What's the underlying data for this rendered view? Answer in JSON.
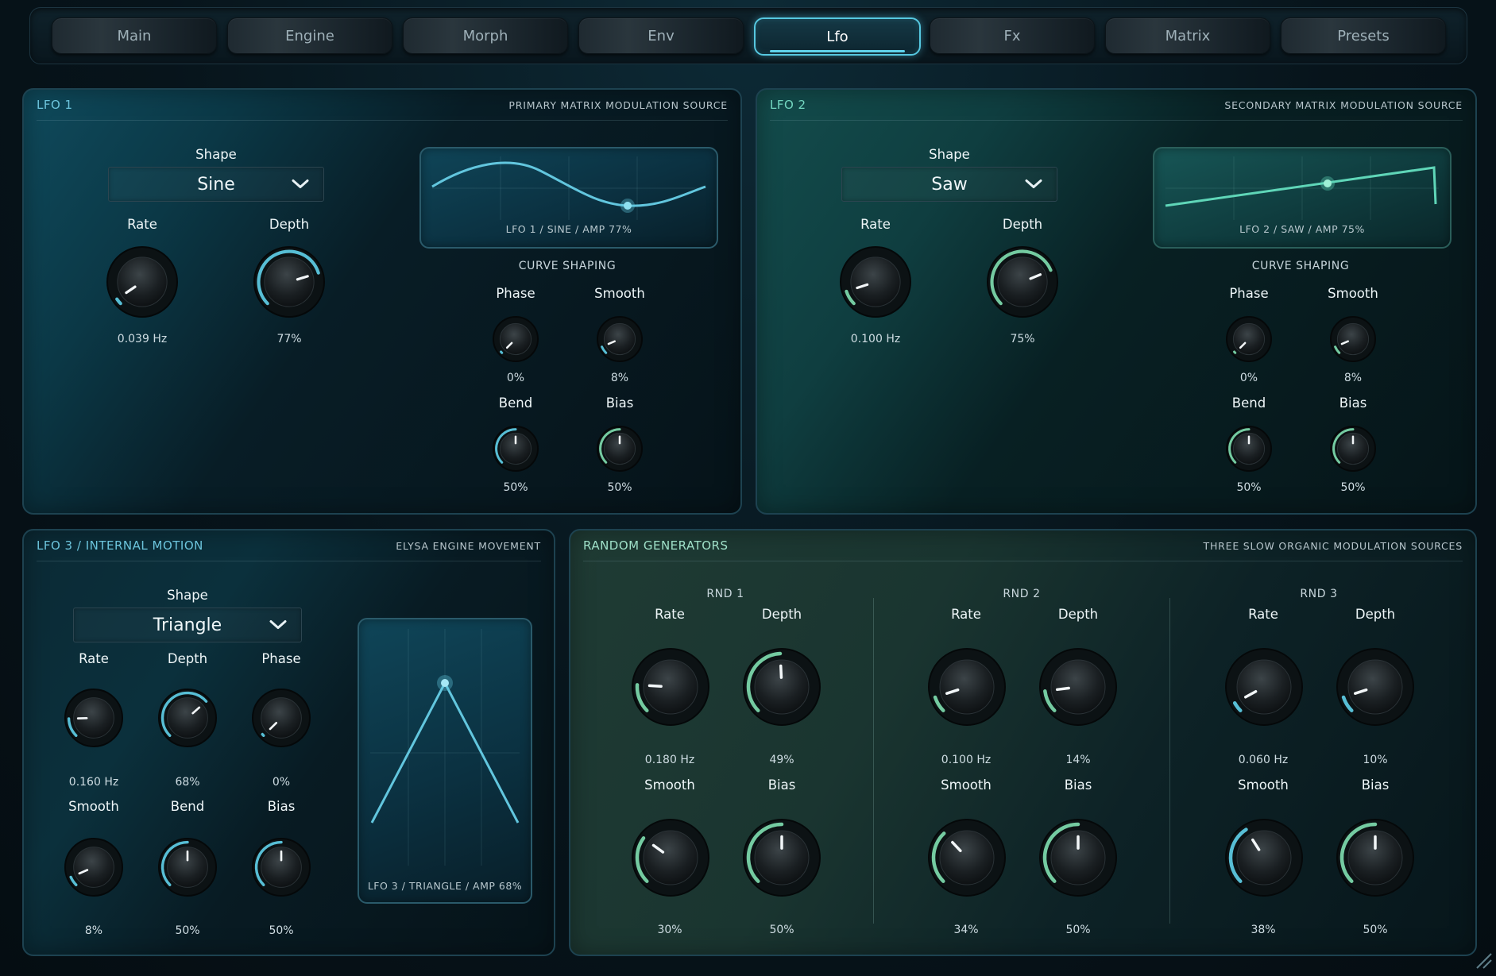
{
  "tabs": [
    {
      "label": "Main"
    },
    {
      "label": "Engine"
    },
    {
      "label": "Morph"
    },
    {
      "label": "Env"
    },
    {
      "label": "Lfo",
      "active": true
    },
    {
      "label": "Fx"
    },
    {
      "label": "Matrix"
    },
    {
      "label": "Presets"
    }
  ],
  "colors": {
    "accent_blue": "#5fd2ea",
    "accent_green": "#7fe0b0",
    "panel_title_blue": "#6cc4dc",
    "panel_title_green": "#73d6c0"
  },
  "lfo1": {
    "title": "LFO 1",
    "subtitle": "PRIMARY MATRIX MODULATION SOURCE",
    "shape_label": "Shape",
    "shape_value": "Sine",
    "rate_label": "Rate",
    "rate_value": "0.039 Hz",
    "rate_level": 0.04,
    "depth_label": "Depth",
    "depth_value": "77%",
    "depth_level": 0.77,
    "display_caption": "LFO 1 / SINE / AMP 77%",
    "curve_title": "CURVE SHAPING",
    "phase_label": "Phase",
    "phase_value": "0%",
    "phase_level": 0.0,
    "smooth_label": "Smooth",
    "smooth_value": "8%",
    "smooth_level": 0.08,
    "bend_label": "Bend",
    "bend_value": "50%",
    "bend_level": 0.5,
    "bias_label": "Bias",
    "bias_value": "50%",
    "bias_level": 0.5
  },
  "lfo2": {
    "title": "LFO 2",
    "subtitle": "SECONDARY MATRIX MODULATION SOURCE",
    "shape_label": "Shape",
    "shape_value": "Saw",
    "rate_label": "Rate",
    "rate_value": "0.100 Hz",
    "rate_level": 0.1,
    "depth_label": "Depth",
    "depth_value": "75%",
    "depth_level": 0.75,
    "display_caption": "LFO 2 / SAW / AMP 75%",
    "curve_title": "CURVE SHAPING",
    "phase_label": "Phase",
    "phase_value": "0%",
    "phase_level": 0.0,
    "smooth_label": "Smooth",
    "smooth_value": "8%",
    "smooth_level": 0.08,
    "bend_label": "Bend",
    "bend_value": "50%",
    "bend_level": 0.5,
    "bias_label": "Bias",
    "bias_value": "50%",
    "bias_level": 0.5
  },
  "lfo3": {
    "title": "LFO 3 / INTERNAL MOTION",
    "subtitle": "ELYSA ENGINE MOVEMENT",
    "shape_label": "Shape",
    "shape_value": "Triangle",
    "rate_label": "Rate",
    "rate_value": "0.160 Hz",
    "rate_level": 0.16,
    "depth_label": "Depth",
    "depth_value": "68%",
    "depth_level": 0.68,
    "phase_label": "Phase",
    "phase_value": "0%",
    "phase_level": 0.0,
    "smooth_label": "Smooth",
    "smooth_value": "8%",
    "smooth_level": 0.08,
    "bend_label": "Bend",
    "bend_value": "50%",
    "bend_level": 0.5,
    "bias_label": "Bias",
    "bias_value": "50%",
    "bias_level": 0.5,
    "display_caption": "LFO 3 / TRIANGLE / AMP 68%"
  },
  "random": {
    "title": "RANDOM GENERATORS",
    "subtitle": "THREE SLOW ORGANIC MODULATION SOURCES",
    "generators": [
      {
        "name": "RND 1",
        "rate_label": "Rate",
        "rate_value": "0.180 Hz",
        "rate_level": 0.18,
        "depth_label": "Depth",
        "depth_value": "49%",
        "depth_level": 0.49,
        "smooth_label": "Smooth",
        "smooth_value": "30%",
        "smooth_level": 0.3,
        "bias_label": "Bias",
        "bias_value": "50%",
        "bias_level": 0.5
      },
      {
        "name": "RND 2",
        "rate_label": "Rate",
        "rate_value": "0.100 Hz",
        "rate_level": 0.1,
        "depth_label": "Depth",
        "depth_value": "14%",
        "depth_level": 0.14,
        "smooth_label": "Smooth",
        "smooth_value": "34%",
        "smooth_level": 0.34,
        "bias_label": "Bias",
        "bias_value": "50%",
        "bias_level": 0.5
      },
      {
        "name": "RND 3",
        "rate_label": "Rate",
        "rate_value": "0.060 Hz",
        "rate_level": 0.06,
        "depth_label": "Depth",
        "depth_value": "10%",
        "depth_level": 0.1,
        "smooth_label": "Smooth",
        "smooth_value": "38%",
        "smooth_level": 0.38,
        "bias_label": "Bias",
        "bias_value": "50%",
        "bias_level": 0.5
      }
    ]
  }
}
